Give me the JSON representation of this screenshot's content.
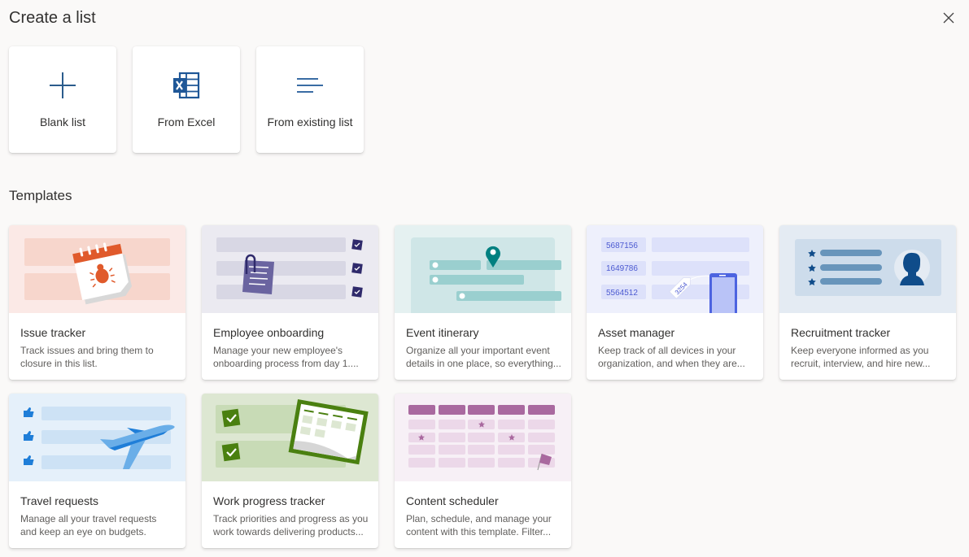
{
  "header": {
    "title": "Create a list",
    "close_icon": "close-icon"
  },
  "create_options": [
    {
      "label": "Blank list",
      "icon": "plus-icon"
    },
    {
      "label": "From Excel",
      "icon": "excel-icon"
    },
    {
      "label": "From existing list",
      "icon": "list-lines-icon"
    }
  ],
  "templates_section": {
    "title": "Templates"
  },
  "templates": [
    {
      "name": "Issue tracker",
      "desc_line1": "Track issues and bring them to",
      "desc_line2": "closure in this list.",
      "bg": "#fbe9e6"
    },
    {
      "name": "Employee onboarding",
      "desc_line1": "Manage your new employee's",
      "desc_line2": "onboarding process from day 1....",
      "bg": "#ebeaf1"
    },
    {
      "name": "Event itinerary",
      "desc_line1": "Organize all your important event",
      "desc_line2": "details in one place, so everything...",
      "bg": "#e5f1f1"
    },
    {
      "name": "Asset manager",
      "desc_line1": "Keep track of all devices in your",
      "desc_line2": "organization, and when they are...",
      "bg": "#eef0fc",
      "asset_ids": [
        "5687156",
        "1649786",
        "5564512"
      ],
      "tag_number": "3254"
    },
    {
      "name": "Recruitment tracker",
      "desc_line1": "Keep everyone informed as you",
      "desc_line2": "recruit, interview, and hire new...",
      "bg": "#e4ebf3"
    },
    {
      "name": "Travel requests",
      "desc_line1": "Manage all your travel requests",
      "desc_line2": "and keep an eye on budgets.",
      "bg": "#e5f0fa"
    },
    {
      "name": "Work progress tracker",
      "desc_line1": "Track priorities and progress as you",
      "desc_line2": "work towards delivering products...",
      "bg": "#dde7d2"
    },
    {
      "name": "Content scheduler",
      "desc_line1": "Plan, schedule, and manage your",
      "desc_line2": "content with this template. Filter...",
      "bg": "#f7f0f6"
    }
  ]
}
